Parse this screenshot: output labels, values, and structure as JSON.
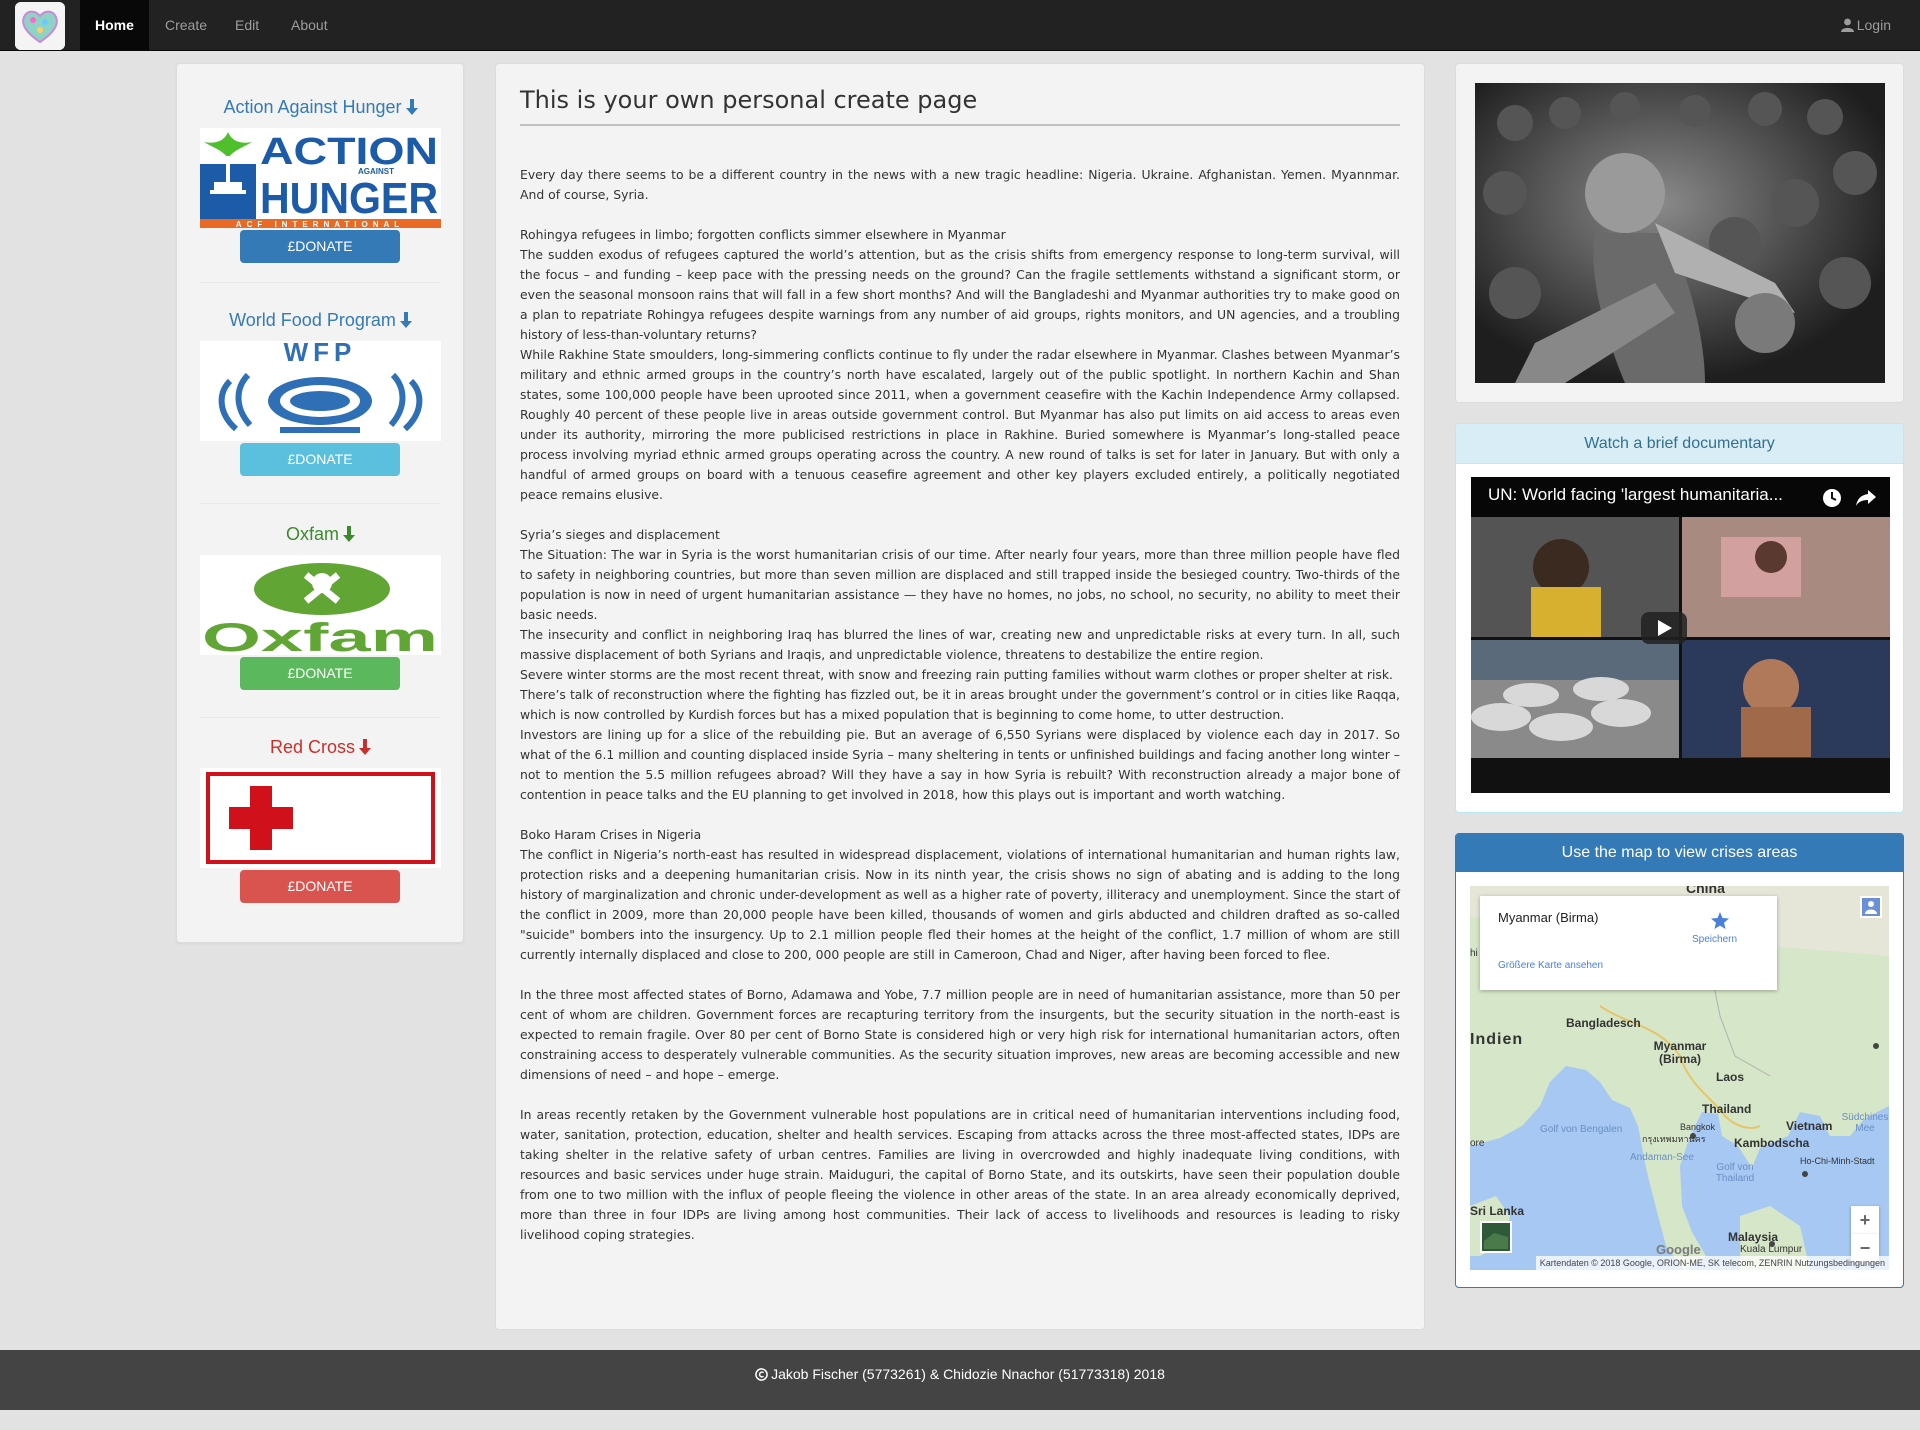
{
  "nav": {
    "items": [
      "Home",
      "Create",
      "Edit",
      "About"
    ],
    "login": "Login"
  },
  "charities": [
    {
      "name": "Action Against Hunger",
      "color": "#337ab7",
      "donate": "£DONATE",
      "donate_color": "#337ab7"
    },
    {
      "name": "World Food Program",
      "color": "#337ab7",
      "donate": "£DONATE",
      "donate_color": "#5bc0de"
    },
    {
      "name": "Oxfam",
      "color": "#3c8a2e",
      "donate": "£DONATE",
      "donate_color": "#5cb85c"
    },
    {
      "name": "Red Cross",
      "color": "#c9302c",
      "donate": "£DONATE",
      "donate_color": "#d9534f"
    }
  ],
  "logos": {
    "aah": {
      "line1": "ACTION",
      "small": "AGAINST",
      "line2": "HUNGER",
      "strip": "ACF INTERNATIONAL"
    },
    "wfp": {
      "text": "WFP"
    },
    "oxfam": {
      "text": "Oxfam"
    }
  },
  "main": {
    "title": "This is your own personal create page",
    "paragraphs": [
      [
        "Every day there seems to be a different country in the news with a new tragic headline: Nigeria. Ukraine. Afghanistan. Yemen. Myannmar. And of course, Syria."
      ],
      [
        "Rohingya refugees in limbo; forgotten conflicts simmer elsewhere in Myanmar",
        "The sudden exodus of refugees captured the world’s attention, but as the crisis shifts from emergency response to long-term survival, will the focus – and funding – keep pace with the pressing needs on the ground? Can the fragile settlements withstand a significant storm, or even the seasonal monsoon rains that will fall in a few short months? And will the Bangladeshi and Myanmar authorities try to make good on a plan to repatriate Rohingya refugees despite warnings from any number of aid groups, rights monitors, and UN agencies, and a troubling history of less-than-voluntary returns?",
        "While Rakhine State smoulders, long-simmering conflicts continue to fly under the radar elsewhere in Myanmar. Clashes between Myanmar’s military and ethnic armed groups in the country’s north have escalated, largely out of the public spotlight. In northern Kachin and Shan states, some 100,000 people have been uprooted since 2011, when a government ceasefire with the Kachin Independence Army collapsed. Roughly 40 percent of these people live in areas outside government control. But Myanmar has also put limits on aid access to areas even under its authority, mirroring the more publicised restrictions in place in Rakhine. Buried somewhere is Myanmar’s long-stalled peace process involving myriad ethnic armed groups operating across the country. A new round of talks is set for later in January. But with only a handful of armed groups on board with a tenuous ceasefire agreement and other key players excluded entirely, a politically negotiated peace remains elusive."
      ],
      [
        "Syria’s sieges and displacement",
        "The Situation: The war in Syria is the worst humanitarian crisis of our time. After nearly four years, more than three million people have fled to safety in neighboring countries, but more than seven million are displaced and still trapped inside the besieged country. Two-thirds of the population is now in need of urgent humanitarian assistance — they have no homes, no jobs, no school, no security, no ability to meet their basic needs.",
        "The insecurity and conflict in neighboring Iraq has blurred the lines of war, creating new and unpredictable risks at every turn. In all, such massive displacement of both Syrians and Iraqis, and unpredictable violence, threatens to destabilize the entire region.",
        "Severe winter storms are the most recent threat, with snow and freezing rain putting families without warm clothes or proper shelter at risk.",
        "There’s talk of reconstruction where the fighting has fizzled out, be it in areas brought under the government’s control or in cities like Raqqa, which is now controlled by Kurdish forces but has a mixed population that is beginning to come home, to utter destruction.",
        "Investors are lining up for a slice of the rebuilding pie. But an average of 6,550 Syrians were displaced by violence each day in 2017. So what of the 6.1 million and counting displaced inside Syria – many sheltering in tents or unfinished buildings and facing another long winter – not to mention the 5.5 million refugees abroad? Will they have a say in how Syria is rebuilt? With reconstruction already a major bone of contention in peace talks and the EU planning to get involved in 2018, how this plays out is important and worth watching."
      ],
      [
        "Boko Haram Crises in Nigeria",
        "The conflict in Nigeria’s north-east has resulted in widespread displacement, violations of international humanitarian and human rights law, protection risks and a deepening humanitarian crisis. Now in its ninth year, the crisis shows no sign of abating and is adding to the long history of marginalization and chronic under-development as well as a higher rate of poverty, illiteracy and unemployment. Since the start of the conflict in 2009, more than 20,000 people have been killed, thousands of women and girls abducted and children drafted as so-called \"suicide\" bombers into the insurgency. Up to 2.1 million people fled their homes at the height of the conflict, 1.7 million of whom are still currently internally displaced and close to 200, 000 people are still in Cameroon, Chad and Niger, after having been forced to flee."
      ],
      [
        "In the three most affected states of Borno, Adamawa and Yobe, 7.7 million people are in need of humanitarian assistance, more than 50 per cent of whom are children. Government forces are recapturing territory from the insurgents, but the security situation in the north-east is expected to remain fragile. Over 80 per cent of Borno State is considered high or very high risk for international humanitarian actors, often constraining access to desperately vulnerable communities. As the security situation improves, new areas are becoming accessible and new dimensions of need – and hope – emerge."
      ],
      [
        "In areas recently retaken by the Government vulnerable host populations are in critical need of humanitarian interventions including food, water, sanitation, protection, education, shelter and health services. Escaping from attacks across the three most-affected states, IDPs are taking shelter in the relative safety of urban centres. Families are living in overcrowded and highly inadequate living conditions, with resources and basic services under huge strain. Maiduguri, the capital of Borno State, and its outskirts, have seen their population double from one to two million with the influx of people fleeing the violence in other areas of the state. In an area already economically deprived, more than three in four IDPs are living among host communities. Their lack of access to livelihoods and resources is leading to risky livelihood coping strategies."
      ]
    ]
  },
  "video_panel": {
    "heading": "Watch a brief documentary",
    "video_title": "UN: World facing 'largest humanitaria..."
  },
  "map_panel": {
    "heading": "Use the map to view crises areas",
    "info_title": "Myanmar (Birma)",
    "save_label": "Speichern",
    "larger_map": "Größere Karte ansehen",
    "labels": {
      "china": "China",
      "india": "Indien",
      "bangladesh": "Bangladesch",
      "myanmar": "Myanmar (Birma)",
      "laos": "Laos",
      "thailand": "Thailand",
      "vietnam": "Vietnam",
      "bangkok": "Bangkok",
      "bangkok_thai": "กรุงเทพมหานคร",
      "cambodia": "Kambodscha",
      "hcmc": "Ho-Chi-Minh-Stadt",
      "srilanka": "Sri Lanka",
      "malaysia": "Malaysia",
      "kl": "Kuala Lumpur",
      "bengal": "Golf von Bengalen",
      "andaman": "Andaman-See",
      "gulf_thai": "Golf von Thailand",
      "scs": "Südchines Mee",
      "google": "Google",
      "ore": "ore",
      "hi": "hi"
    },
    "attribution": "Kartendaten © 2018 Google, ORION-ME, SK telecom, ZENRIN    Nutzungsbedingungen",
    "zoom_in": "+",
    "zoom_out": "−"
  },
  "footer": {
    "text": "Jakob Fischer (5773261) & Chidozie Nnachor (51773318) 2018"
  }
}
